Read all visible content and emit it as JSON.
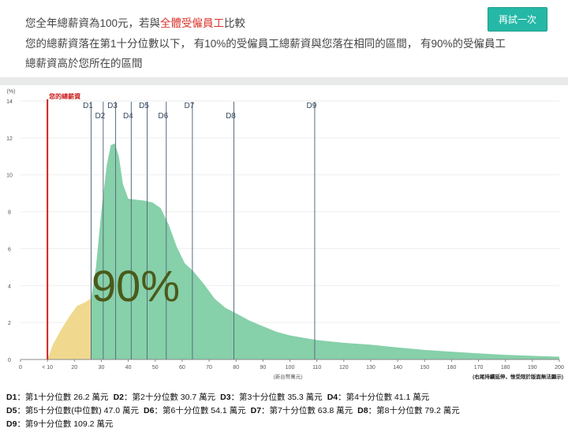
{
  "header": {
    "line1_pre": "您全年總薪資為100元，若與",
    "line1_highlight": "全體受僱員工",
    "line1_post": "比較",
    "line2": "您的總薪資落在第1十分位數以下， 有10%的受僱員工總薪資與您落在相同的區間， 有90%的受僱員工",
    "line3": "總薪資高於您所在的區間",
    "retry_label": "再試一次"
  },
  "chart_data": {
    "type": "area",
    "y_unit": "(%)",
    "x_unit": "(新台幣萬元)",
    "tail_note": "(右尾持續延伸，惟受限於版面無法顯示)",
    "your_salary_label": "您的總薪資",
    "your_salary_x": 10,
    "big_percent_label": "90%",
    "x_ticks": [
      "0",
      "< 10",
      "20",
      "30",
      "40",
      "50",
      "60",
      "70",
      "80",
      "90",
      "100",
      "110",
      "120",
      "130",
      "140",
      "150",
      "160",
      "170",
      "180",
      "190",
      "200"
    ],
    "y_ticks": [
      "0",
      "2",
      "4",
      "6",
      "8",
      "10",
      "12",
      "14"
    ],
    "xlim": [
      0,
      200
    ],
    "ylim": [
      0,
      14
    ],
    "density": [
      [
        10,
        0
      ],
      [
        12,
        0.8
      ],
      [
        15,
        1.6
      ],
      [
        18,
        2.3
      ],
      [
        21,
        2.9
      ],
      [
        24,
        3.1
      ],
      [
        26.2,
        3.3
      ],
      [
        28,
        5
      ],
      [
        30,
        8
      ],
      [
        32,
        10.5
      ],
      [
        33.5,
        11.6
      ],
      [
        35,
        11.7
      ],
      [
        36.5,
        11
      ],
      [
        38,
        9.5
      ],
      [
        40,
        8.7
      ],
      [
        43,
        8.65
      ],
      [
        46,
        8.6
      ],
      [
        49,
        8.5
      ],
      [
        52,
        8.2
      ],
      [
        55,
        7.3
      ],
      [
        58,
        6.1
      ],
      [
        61,
        5.2
      ],
      [
        64,
        4.8
      ],
      [
        68,
        4.1
      ],
      [
        72,
        3.3
      ],
      [
        76,
        2.8
      ],
      [
        80,
        2.5
      ],
      [
        85,
        2.1
      ],
      [
        90,
        1.8
      ],
      [
        95,
        1.5
      ],
      [
        100,
        1.3
      ],
      [
        110,
        1.05
      ],
      [
        120,
        0.9
      ],
      [
        130,
        0.8
      ],
      [
        140,
        0.65
      ],
      [
        150,
        0.52
      ],
      [
        160,
        0.42
      ],
      [
        170,
        0.33
      ],
      [
        180,
        0.25
      ],
      [
        190,
        0.2
      ],
      [
        200,
        0.15
      ]
    ],
    "deciles": [
      {
        "name": "D1",
        "x": 26.2
      },
      {
        "name": "D2",
        "x": 30.7
      },
      {
        "name": "D3",
        "x": 35.3
      },
      {
        "name": "D4",
        "x": 41.1
      },
      {
        "name": "D5",
        "x": 47.0
      },
      {
        "name": "D6",
        "x": 54.1
      },
      {
        "name": "D7",
        "x": 63.8
      },
      {
        "name": "D8",
        "x": 79.2
      },
      {
        "name": "D9",
        "x": 109.2
      }
    ],
    "colors": {
      "below": "#f0d98e",
      "above": "#86d0aa",
      "your_line": "#cc1f1f",
      "decile_line": "#5a6c7d",
      "big_text": "#4a5a1a"
    }
  },
  "legend": [
    [
      {
        "key": "D1",
        "text": "：第1十分位數 26.2 萬元"
      },
      {
        "key": "D2",
        "text": "：第2十分位數 30.7 萬元"
      },
      {
        "key": "D3",
        "text": "：第3十分位數 35.3 萬元"
      },
      {
        "key": "D4",
        "text": "：第4十分位數 41.1 萬元"
      }
    ],
    [
      {
        "key": "D5",
        "text": "：第5十分位數(中位數) 47.0 萬元"
      },
      {
        "key": "D6",
        "text": "：第6十分位數 54.1 萬元"
      },
      {
        "key": "D7",
        "text": "：第7十分位數 63.8 萬元"
      },
      {
        "key": "D8",
        "text": "：第8十分位數 79.2 萬元"
      }
    ],
    [
      {
        "key": "D9",
        "text": "：第9十分位數 109.2 萬元"
      }
    ]
  ]
}
